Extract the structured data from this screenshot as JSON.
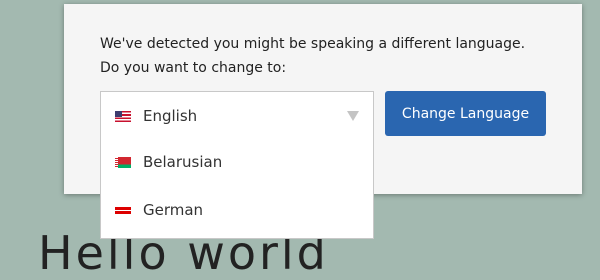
{
  "background": {
    "heading_fragment": "Hello world"
  },
  "modal": {
    "line1": "We've detected you might be speaking a different language.",
    "line2": "Do you want to change to:"
  },
  "language_select": {
    "options": [
      {
        "label": "English",
        "flag": "us-flag-icon",
        "selected": true
      },
      {
        "label": "Belarusian",
        "flag": "belarus-flag-icon",
        "selected": false
      },
      {
        "label": "German",
        "flag": "germany-flag-icon",
        "selected": false
      }
    ],
    "caret_icon": "caret-down-icon"
  },
  "change_button": {
    "label": "Change Language",
    "color": "#2a66b0"
  },
  "colors": {
    "page_background": "#a3b9b0",
    "modal_background": "#f5f5f5"
  }
}
